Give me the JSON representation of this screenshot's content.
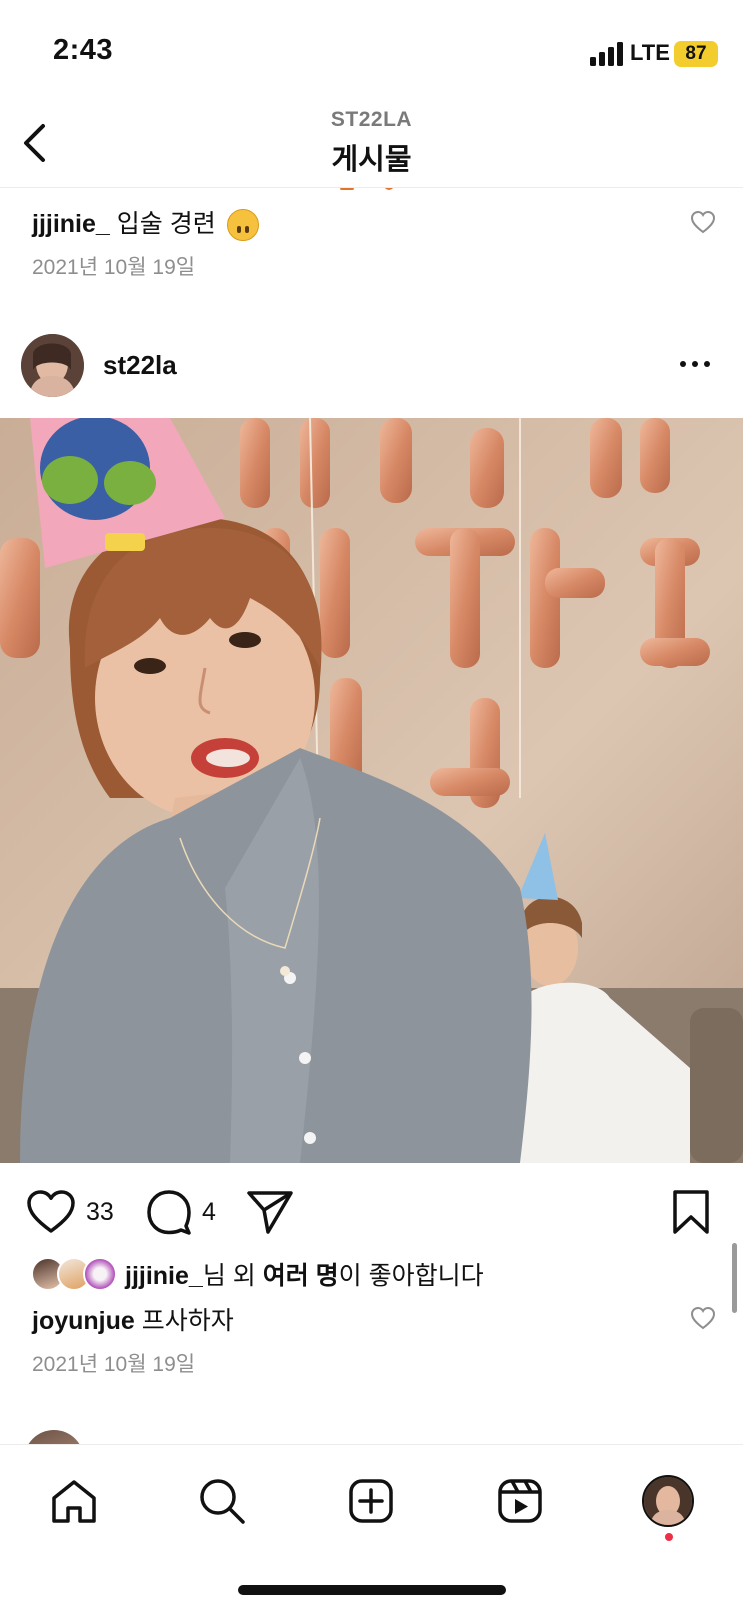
{
  "status_bar": {
    "time": "2:43",
    "network": "LTE",
    "battery": "87"
  },
  "header": {
    "subtitle": "ST22LA",
    "title": "게시물"
  },
  "previous_post": {
    "caption_user": "jjjinie_",
    "caption_text": "입술 경련",
    "date": "2021년 10월 19일"
  },
  "post": {
    "username": "st22la",
    "like_count": "33",
    "comment_count": "4",
    "likes_summary": {
      "user": "jjjinie_",
      "mid": "님 외 ",
      "others": "여러 명",
      "tail": "이 좋아합니다"
    },
    "comment": {
      "user": "joyunjue",
      "text": "프사하자"
    },
    "date": "2021년 10월 19일"
  },
  "icons": {
    "back": "chevron-left-icon",
    "more": "more-horizontal-icon",
    "like": "heart-icon",
    "comment": "comment-bubble-icon",
    "share": "paper-plane-icon",
    "save": "bookmark-icon",
    "tabs": [
      "home-icon",
      "search-icon",
      "create-icon",
      "reels-icon",
      "profile-avatar"
    ]
  },
  "colors": {
    "battery": "#f3cd2e",
    "notification_dot": "#ed2f48",
    "muted_text": "#8e8e8e"
  }
}
